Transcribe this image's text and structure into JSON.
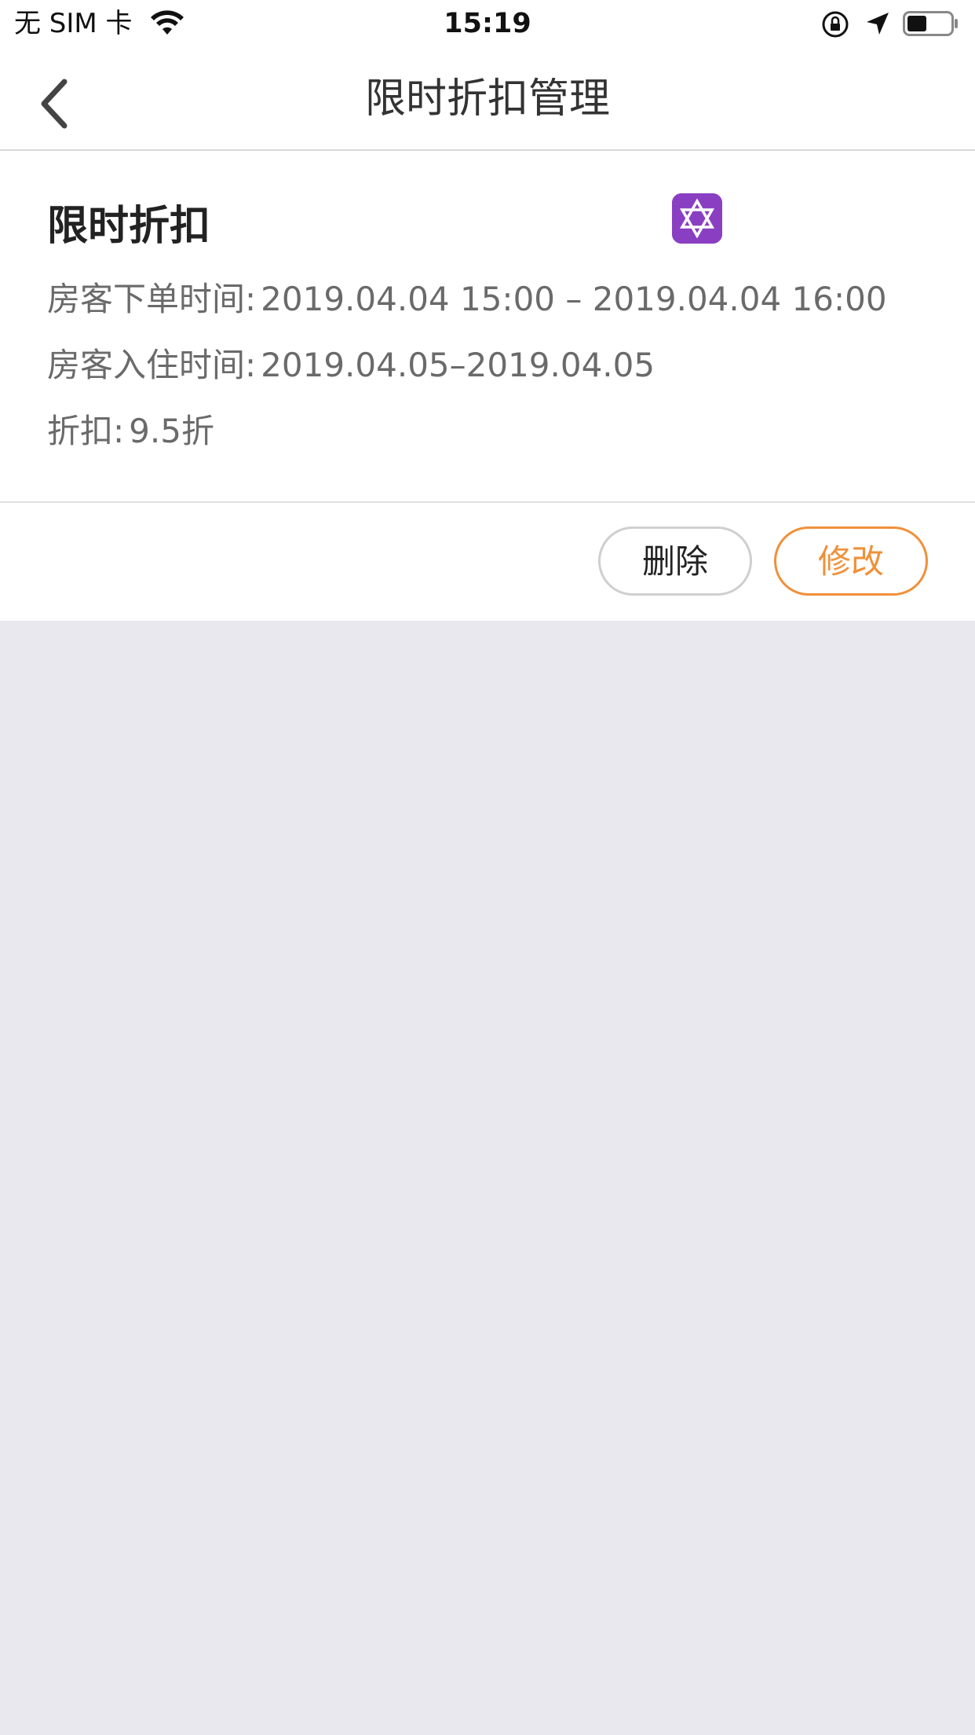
{
  "status_bar": {
    "carrier": "无 SIM 卡",
    "time": "15:19"
  },
  "nav": {
    "title": "限时折扣管理"
  },
  "card": {
    "title": "限时折扣",
    "order_time_label": "房客下单时间:",
    "order_time_value": "2019.04.04 15:00 – 2019.04.04 16:00",
    "checkin_time_label": "房客入住时间:",
    "checkin_time_value": "2019.04.05–2019.04.05",
    "discount_label": "折扣:",
    "discount_value": "9.5折"
  },
  "actions": {
    "delete_label": "删除",
    "edit_label": "修改"
  },
  "colors": {
    "accent": "#f0903a",
    "background": "#e9e8ee",
    "badge": "#8a3fc3"
  },
  "icons": {
    "back": "chevron-left-icon",
    "badge": "star-of-david-icon"
  }
}
